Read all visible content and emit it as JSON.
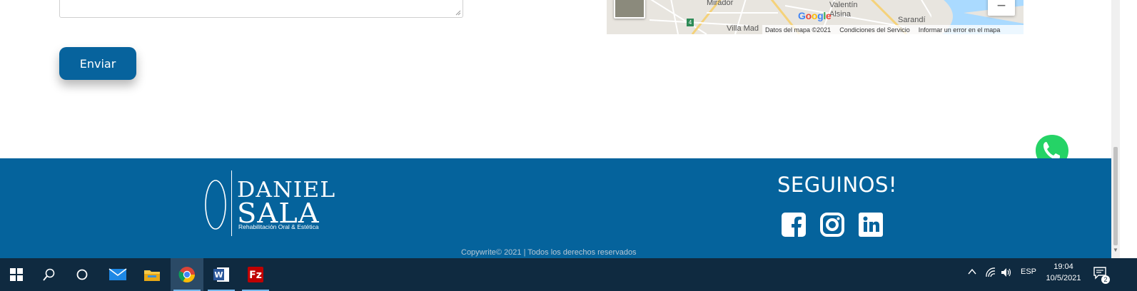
{
  "form": {
    "send_label": "Enviar"
  },
  "map": {
    "labels": {
      "mirador": "Mirador",
      "valentin": "Valentín",
      "alsina": "Alsina",
      "sarandi": "Sarandí",
      "villa": "Villa Mad",
      "route": "4"
    },
    "google": "Google",
    "footer": {
      "map_data": "Datos del mapa ©2021",
      "terms": "Condiciones del Servicio",
      "report": "Informar un error en el mapa"
    },
    "zoom_out": "−"
  },
  "footer": {
    "logo": {
      "line1": "DANIEL",
      "line2": "SALA",
      "subtitle": "Rehabilitación Oral & Estética"
    },
    "follow_title": "SEGUINOS!",
    "social": [
      "facebook-icon",
      "instagram-icon",
      "linkedin-icon"
    ],
    "copyright": "Copywrite© 2021 | Todos los derechos reservados"
  },
  "taskbar": {
    "lang": "ESP",
    "time": "19:04",
    "date": "10/5/2021",
    "notifications": "2"
  },
  "colors": {
    "brand_blue": "#05639c",
    "button_blue": "#07639d",
    "taskbar": "#0f2a40",
    "whatsapp": "#25d366"
  }
}
